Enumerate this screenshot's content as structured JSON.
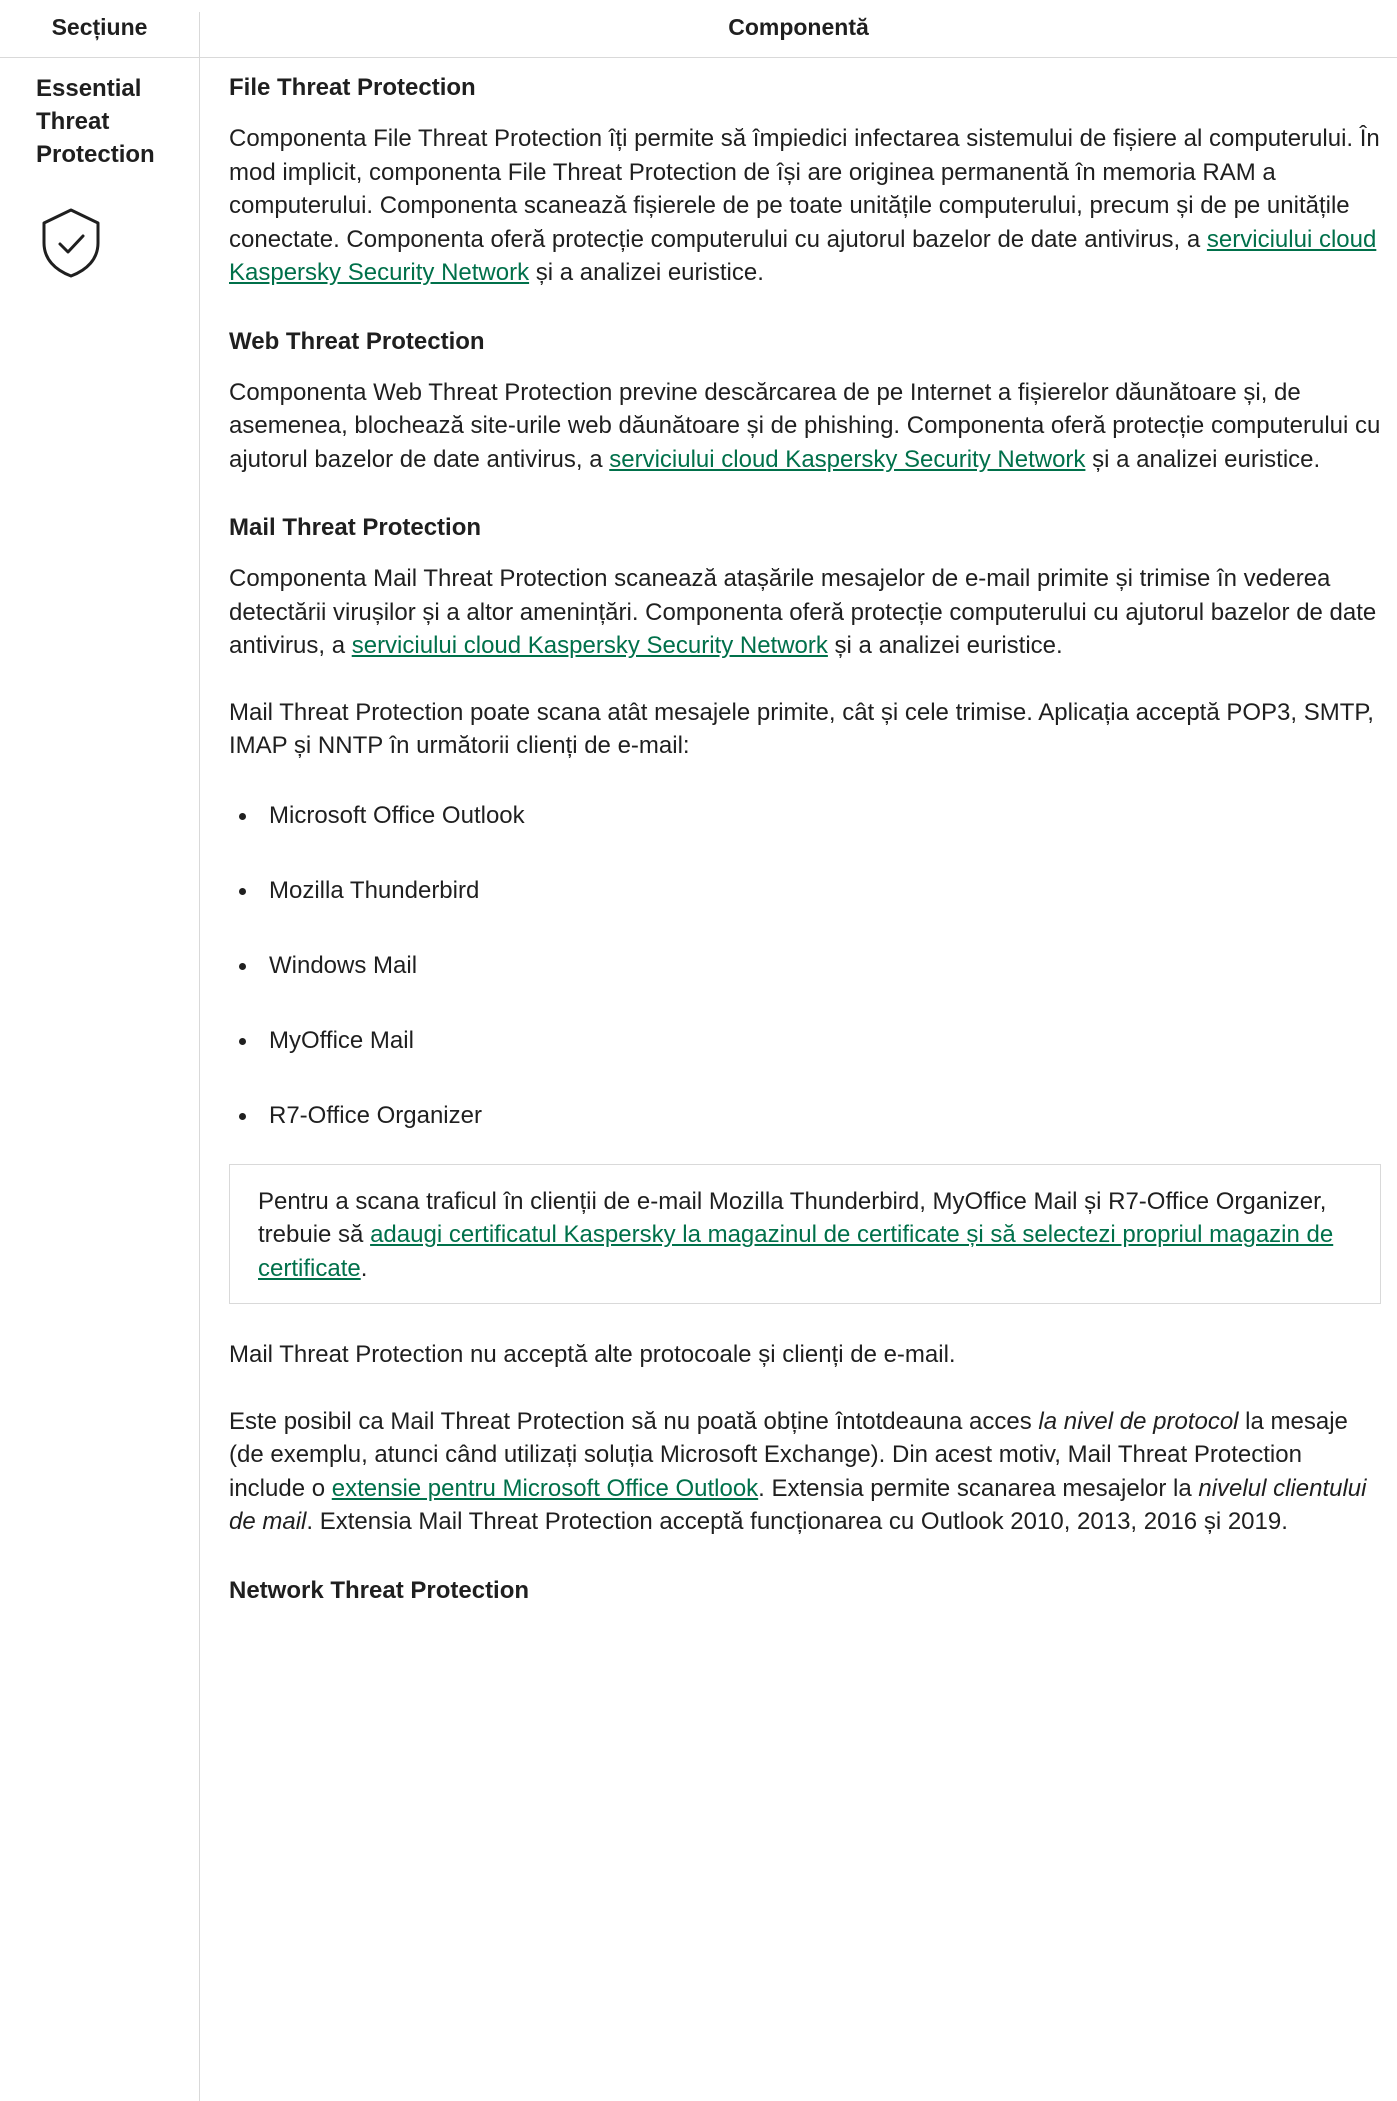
{
  "header": {
    "col_section": "Secțiune",
    "col_component": "Componentă"
  },
  "section": {
    "title": "Essential\nThreat\nProtection",
    "icon": "shield-check-icon"
  },
  "file_threat": {
    "heading": "File Threat Protection",
    "text_before": "Componenta File Threat Protection îți permite să împiedici infectarea sistemului de fișiere al computerului. În mod implicit, componenta File Threat Protection de își are originea permanentă în memoria RAM a computerului. Componenta scanează fișierele de pe toate unitățile computerului, precum și de pe unitățile conectate. Componenta oferă protecție computerului cu ajutorul bazelor de date antivirus, a ",
    "link": "serviciului cloud Kaspersky Security Network",
    "text_after": " și a analizei euristice."
  },
  "web_threat": {
    "heading": "Web Threat Protection",
    "text_before": "Componenta Web Threat Protection previne descărcarea de pe Internet a fișierelor dăunătoare și, de asemenea, blochează site-urile web dăunătoare și de phishing. Componenta oferă protecție computerului cu ajutorul bazelor de date antivirus, a ",
    "link": "serviciului cloud Kaspersky Security Network",
    "text_after": " și a analizei euristice."
  },
  "mail_threat": {
    "heading": "Mail Threat Protection",
    "p1_before": "Componenta Mail Threat Protection scanează atașările mesajelor de e-mail primite și trimise în vederea detectării virușilor și a altor amenințări. Componenta oferă protecție computerului cu ajutorul bazelor de date antivirus, a ",
    "p1_link": "serviciului cloud Kaspersky Security Network",
    "p1_after": " și a analizei euristice.",
    "p2": "Mail Threat Protection poate scana atât mesajele primite, cât și cele trimise. Aplicația acceptă POP3, SMTP, IMAP și NNTP în următorii clienți de e-mail:",
    "clients": [
      "Microsoft Office Outlook",
      "Mozilla Thunderbird",
      "Windows Mail",
      "MyOffice Mail",
      "R7-Office Organizer"
    ],
    "note_before": "Pentru a scana traficul în clienții de e-mail Mozilla Thunderbird, MyOffice Mail și R7-Office Organizer, trebuie să ",
    "note_link": "adaugi certificatul Kaspersky la magazinul de certificate și să selectezi propriul magazin de certificate",
    "note_after": ".",
    "p3": "Mail Threat Protection nu acceptă alte protocoale și clienți de e-mail.",
    "p4_a": "Este posibil ca Mail Threat Protection să nu poată obține întotdeauna acces ",
    "p4_em1": "la nivel de protocol",
    "p4_b": " la mesaje (de exemplu, atunci când utilizați soluția Microsoft Exchange). Din acest motiv, Mail Threat Protection include o ",
    "p4_link": "extensie pentru Microsoft Office Outlook",
    "p4_c": ". Extensia permite scanarea mesajelor la ",
    "p4_em2": "nivelul clientului de mail",
    "p4_d": ". Extensia Mail Threat Protection acceptă funcționarea cu Outlook 2010, 2013, 2016 și 2019."
  },
  "network_threat": {
    "heading": "Network Threat Protection"
  },
  "colors": {
    "link": "#00704a",
    "border": "#d9d9d9",
    "text": "#1f1f1f"
  }
}
